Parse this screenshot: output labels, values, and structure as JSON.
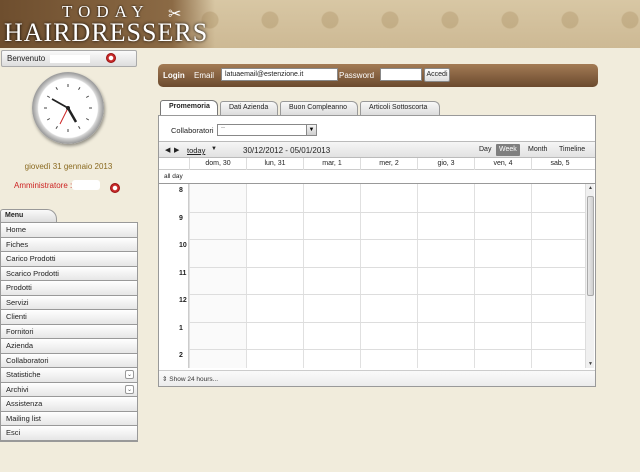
{
  "brand": {
    "top": "TODAY",
    "main": "HAIRDRESSERS"
  },
  "sidebar": {
    "welcome": "Benvenuto",
    "date": "giovedì 31 gennaio 2013",
    "admin": "Amministratore :",
    "menu_title": "Menu",
    "items": [
      {
        "label": "Home",
        "expand": false
      },
      {
        "label": "Fiches",
        "expand": false
      },
      {
        "label": "Carico Prodotti",
        "expand": false
      },
      {
        "label": "Scarico Prodotti",
        "expand": false
      },
      {
        "label": "Prodotti",
        "expand": false
      },
      {
        "label": "Servizi",
        "expand": false
      },
      {
        "label": "Clienti",
        "expand": false
      },
      {
        "label": "Fornitori",
        "expand": false
      },
      {
        "label": "Azienda",
        "expand": false
      },
      {
        "label": "Collaboratori",
        "expand": false
      },
      {
        "label": "Statistiche",
        "expand": true
      },
      {
        "label": "Archivi",
        "expand": true
      },
      {
        "label": "Assistenza",
        "expand": false
      },
      {
        "label": "Mailing list",
        "expand": false
      },
      {
        "label": "Esci",
        "expand": false
      }
    ]
  },
  "login": {
    "title": "Login",
    "email_label": "Email",
    "email_value": "latuaemail@estenzione.it",
    "password_label": "Password",
    "password_value": "",
    "submit": "Accedi"
  },
  "tabs": [
    "Promemoria",
    "Dati Azienda",
    "Buon Compleanno",
    "Articoli Sottoscorta"
  ],
  "calendar": {
    "collaboratori_label": "Collaboratori",
    "collaboratori_value": "--",
    "today": "today",
    "range": "30/12/2012 - 05/01/2013",
    "views": [
      "Day",
      "Week",
      "Month",
      "Timeline"
    ],
    "active_view": "Week",
    "days": [
      "dom, 30",
      "lun, 31",
      "mar, 1",
      "mer, 2",
      "gio, 3",
      "ven, 4",
      "sab, 5"
    ],
    "all_day": "all day",
    "hours": [
      "8",
      "9",
      "10",
      "11",
      "12",
      "1",
      "2"
    ],
    "show24": "Show 24 hours..."
  }
}
